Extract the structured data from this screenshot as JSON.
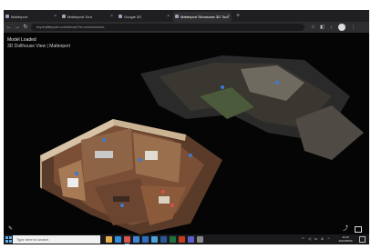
{
  "browser": {
    "tabs": [
      {
        "label": "Matterport",
        "active": false
      },
      {
        "label": "Matterport Tour",
        "active": false
      },
      {
        "label": "Google 3D",
        "active": false
      },
      {
        "label": "Matterport Showcase 3D Tour",
        "active": true
      }
    ],
    "url": "my.matterport.com/show/?m=xxxxxxxxxxx",
    "new_tab_symbol": "+"
  },
  "viewer": {
    "title": "Model Loaded",
    "subtitle": "3D Dollhouse View | Matterport"
  },
  "taskbar": {
    "search_placeholder": "Type here to search",
    "time": "11:43",
    "date": "2021/05/04",
    "apps": [
      {
        "name": "file-explorer-icon",
        "color": "#e8b04a"
      },
      {
        "name": "edge-browser-icon",
        "color": "#2f8fe0"
      },
      {
        "name": "chrome-icon",
        "color": "#d9534f",
        "active": true
      },
      {
        "name": "store-icon",
        "color": "#3e86d6"
      },
      {
        "name": "mail-icon",
        "color": "#2f6fbf"
      },
      {
        "name": "photos-icon",
        "color": "#4aa3e0"
      },
      {
        "name": "word-icon",
        "color": "#2b5797"
      },
      {
        "name": "excel-icon",
        "color": "#1e7145"
      },
      {
        "name": "powerpoint-icon",
        "color": "#c43e1c"
      },
      {
        "name": "teams-icon",
        "color": "#5b5fc7"
      },
      {
        "name": "settings-icon",
        "color": "#8a8a8a"
      }
    ]
  },
  "colors": {
    "floor": "#8a5a3a",
    "wall": "#d6c2a6",
    "accent_marker": "#3a7bd5"
  }
}
